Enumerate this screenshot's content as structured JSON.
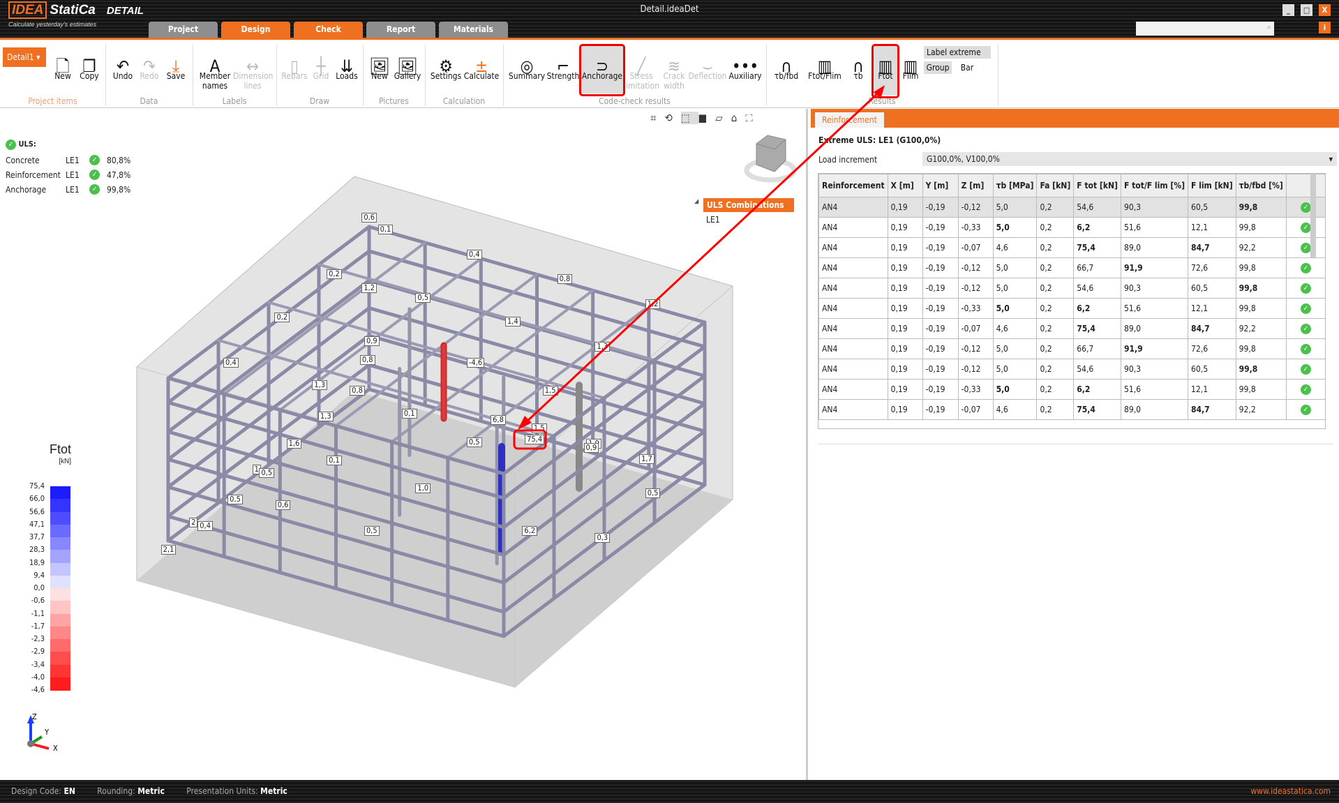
{
  "app": {
    "logo": "IDEA StatiCa",
    "product": "DETAIL",
    "slogan": "Calculate yesterday's estimates",
    "window_title": "Detail.ideaDet"
  },
  "tabs": [
    "Project",
    "Design",
    "Check",
    "Report",
    "Materials"
  ],
  "ribbon": {
    "project_select": "Detail1",
    "new": "New",
    "copy": "Copy",
    "undo": "Undo",
    "redo": "Redo",
    "save": "Save",
    "member_names": "Member names",
    "dimension_lines": "Dimension lines",
    "rebars": "Rebars",
    "grid": "Grid",
    "loads": "Loads",
    "pic_new": "New",
    "gallery": "Gallery",
    "settings": "Settings",
    "calculate": "Calculate",
    "summary": "Summary",
    "strength": "Strength",
    "anchorage": "Anchorage",
    "stress_limitation": "Stress limitation",
    "crack_width": "Crack width",
    "deflection": "Deflection",
    "auxiliary": "Auxiliary",
    "res_tb_fbd": "τb/fbd",
    "res_ftot_flim": "Ftot/Flim",
    "res_tb": "τb",
    "res_ftot": "Ftot",
    "res_flim": "Flim",
    "label_extreme": "Label extreme",
    "group": "Group",
    "bar": "Bar",
    "groups": [
      "Project items",
      "Data",
      "Labels",
      "Draw",
      "Pictures",
      "Calculation",
      "Code-check results",
      "Results"
    ]
  },
  "summary": {
    "title": "ULS:",
    "rows": [
      {
        "name": "Concrete",
        "le": "LE1",
        "value": "80,8%"
      },
      {
        "name": "Reinforcement",
        "le": "LE1",
        "value": "47,8%"
      },
      {
        "name": "Anchorage",
        "le": "LE1",
        "value": "99,8%"
      }
    ]
  },
  "tree": {
    "header": "ULS Combinations",
    "item": "LE1"
  },
  "legend": {
    "title": "Ftot",
    "unit": "[kN]",
    "values": [
      "75,4",
      "66,0",
      "56,6",
      "47,1",
      "37,7",
      "28,3",
      "18,9",
      "9,4",
      "0,0",
      "-0,6",
      "-1,1",
      "-1,7",
      "-2,3",
      "-2,9",
      "-3,4",
      "-4,0",
      "-4,6"
    ],
    "colors": [
      "#1c1cff",
      "#3434ff",
      "#4d4dff",
      "#6a6aff",
      "#8787ff",
      "#a4a4ff",
      "#c4c4ff",
      "#e0e0ff",
      "#ffe0e0",
      "#ffc4c4",
      "#ffa4a4",
      "#ff8787",
      "#ff6a6a",
      "#ff4d4d",
      "#ff3434",
      "#ff1c1c"
    ]
  },
  "axes": {
    "z": "Z",
    "y": "Y",
    "x": "X"
  },
  "view_labels": [
    "0,6",
    "0,1",
    "0,4",
    "0,2",
    "1,2",
    "0,8",
    "0,5",
    "1,2",
    "0,2",
    "1,4",
    "0,9",
    "1,3",
    "0,4",
    "0,8",
    "-4,6",
    "1,3",
    "0,8",
    "1,5",
    "0,1",
    "1,3",
    "6,8",
    "1,5",
    "75,4",
    "0,5",
    "1,6",
    "1,9",
    "0,9",
    "0,1",
    "1,7",
    "1",
    "0,5",
    "1,0",
    "0,5",
    "0,5",
    "0,6",
    "2",
    "0,4",
    "0,5",
    "6,2",
    "0,3",
    "2,1"
  ],
  "panel": {
    "tab": "Reinforcement",
    "title": "Extreme ULS: LE1 (G100,0%)",
    "load_increment_label": "Load increment",
    "load_increment_value": "G100,0%, V100,0%",
    "columns": [
      "Reinforcement",
      "X [m]",
      "Y [m]",
      "Z [m]",
      "τb [MPa]",
      "Fa [kN]",
      "F tot [kN]",
      "F tot/F lim [%]",
      "F lim [kN]",
      "τb/fbd [%]",
      ""
    ],
    "rows": [
      [
        "AN4",
        "0,19",
        "-0,19",
        "-0,12",
        "5,0",
        "0,2",
        "54,6",
        "90,3",
        "60,5",
        "99,8"
      ],
      [
        "AN4",
        "0,19",
        "-0,19",
        "-0,33",
        "5,0",
        "0,2",
        "6,2",
        "51,6",
        "12,1",
        "99,8"
      ],
      [
        "AN4",
        "0,19",
        "-0,19",
        "-0,07",
        "4,6",
        "0,2",
        "75,4",
        "89,0",
        "84,7",
        "92,2"
      ],
      [
        "AN4",
        "0,19",
        "-0,19",
        "-0,12",
        "5,0",
        "0,2",
        "66,7",
        "91,9",
        "72,6",
        "99,8"
      ],
      [
        "AN4",
        "0,19",
        "-0,19",
        "-0,12",
        "5,0",
        "0,2",
        "54,6",
        "90,3",
        "60,5",
        "99,8"
      ],
      [
        "AN4",
        "0,19",
        "-0,19",
        "-0,33",
        "5,0",
        "0,2",
        "6,2",
        "51,6",
        "12,1",
        "99,8"
      ],
      [
        "AN4",
        "0,19",
        "-0,19",
        "-0,07",
        "4,6",
        "0,2",
        "75,4",
        "89,0",
        "84,7",
        "92,2"
      ],
      [
        "AN4",
        "0,19",
        "-0,19",
        "-0,12",
        "5,0",
        "0,2",
        "66,7",
        "91,9",
        "72,6",
        "99,8"
      ],
      [
        "AN4",
        "0,19",
        "-0,19",
        "-0,12",
        "5,0",
        "0,2",
        "54,6",
        "90,3",
        "60,5",
        "99,8"
      ],
      [
        "AN4",
        "0,19",
        "-0,19",
        "-0,33",
        "5,0",
        "0,2",
        "6,2",
        "51,6",
        "12,1",
        "99,8"
      ],
      [
        "AN4",
        "0,19",
        "-0,19",
        "-0,07",
        "4,6",
        "0,2",
        "75,4",
        "89,0",
        "84,7",
        "92,2"
      ]
    ],
    "bold": [
      [
        9
      ],
      [
        4,
        6
      ],
      [
        6,
        8
      ],
      [
        7
      ],
      [
        9
      ],
      [
        4,
        6
      ],
      [
        6,
        8
      ],
      [
        7
      ],
      [
        9
      ],
      [
        4,
        6
      ],
      [
        6,
        8
      ]
    ]
  },
  "status": {
    "design_code_label": "Design Code:",
    "design_code": "EN",
    "rounding_label": "Rounding:",
    "rounding": "Metric",
    "units_label": "Presentation Units:",
    "units": "Metric",
    "website": "www.ideastatica.com"
  },
  "colors": {
    "accent": "#f07022",
    "highlight": "#e00000",
    "ok": "#4cc04c"
  }
}
